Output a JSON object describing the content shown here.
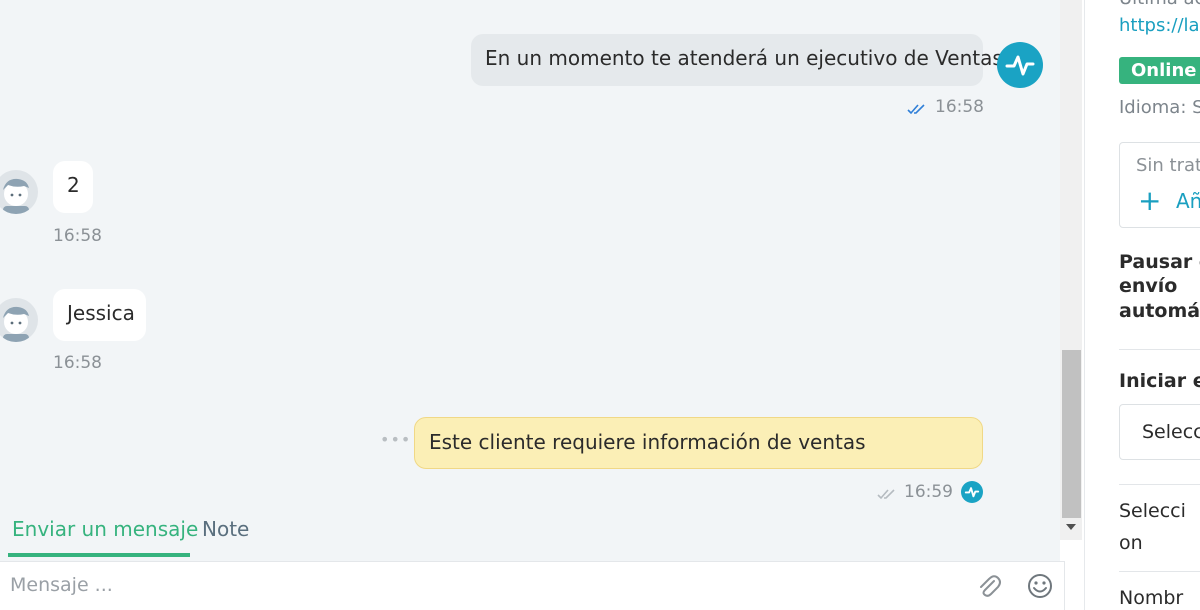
{
  "messages": [
    {
      "author": "agent",
      "text": "En un momento te atenderá un ejecutivo de Ventas",
      "time": "16:58"
    },
    {
      "author": "customer",
      "text": "2",
      "time": "16:58"
    },
    {
      "author": "customer",
      "text": "Jessica",
      "time": "16:58"
    },
    {
      "author": "agent",
      "type": "note",
      "text": "Este cliente requiere información de ventas",
      "time": "16:59"
    }
  ],
  "composer": {
    "tabs": [
      {
        "label": "Enviar un mensaje",
        "active": true
      },
      {
        "label": "Note",
        "active": false
      }
    ],
    "placeholder": "Mensaje ...",
    "icons": [
      "paperclip-icon",
      "emoji-icon"
    ]
  },
  "sidebar": {
    "last_activity_label": "Última ac",
    "last_activity_url": "https://lar",
    "status_badge": "Online",
    "language": "Idioma: S",
    "deals_card": {
      "empty_label": "Sin trato",
      "add_label": "Añ"
    },
    "pause_label": [
      "Pausar e",
      "envío",
      "automát"
    ],
    "start_label": "Iniciar el",
    "select_placeholder": "Selecc",
    "selection_label": [
      "Selecci",
      "on"
    ],
    "name_label": "Nombr"
  },
  "colors": {
    "accent_green": "#36b37e",
    "brand_blue": "#1aa3c4",
    "link_blue": "#1a9fc0",
    "note_yellow": "#fbefb6",
    "chat_background": "#f2f5f7"
  }
}
